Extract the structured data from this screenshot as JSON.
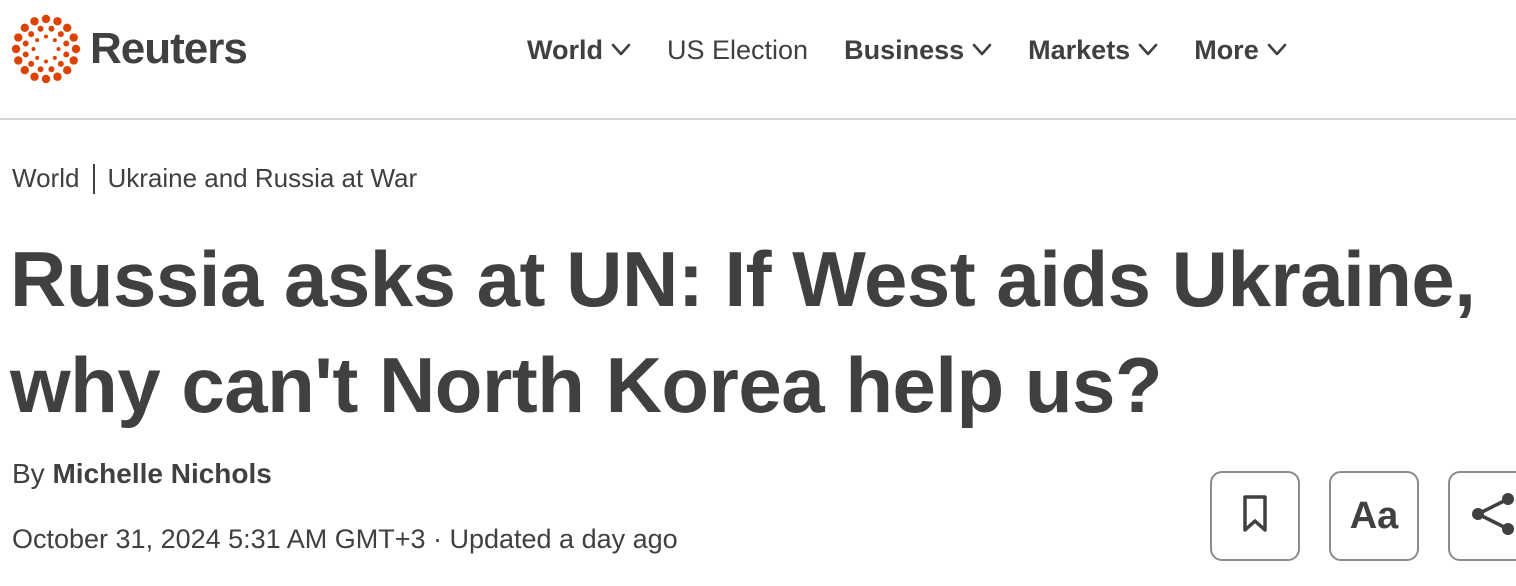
{
  "brand": {
    "name": "Reuters",
    "accent_color": "#dc4300",
    "text_color": "#404040"
  },
  "nav": {
    "items": [
      {
        "label": "World",
        "has_dropdown": true
      },
      {
        "label": "US Election",
        "has_dropdown": false
      },
      {
        "label": "Business",
        "has_dropdown": true
      },
      {
        "label": "Markets",
        "has_dropdown": true
      },
      {
        "label": "More",
        "has_dropdown": true
      }
    ]
  },
  "breadcrumb": {
    "section": "World",
    "topic": "Ukraine and Russia at War"
  },
  "article": {
    "headline": "Russia asks at UN: If West aids Ukraine, why can't North Korea help us?",
    "byline_prefix": "By",
    "author": "Michelle Nichols",
    "dateline": "October 31, 2024 5:31 AM GMT+3 · Updated a day ago"
  },
  "actions": {
    "bookmark_icon": "bookmark-icon",
    "font_size_label": "Aa",
    "share_icon": "share-icon"
  }
}
